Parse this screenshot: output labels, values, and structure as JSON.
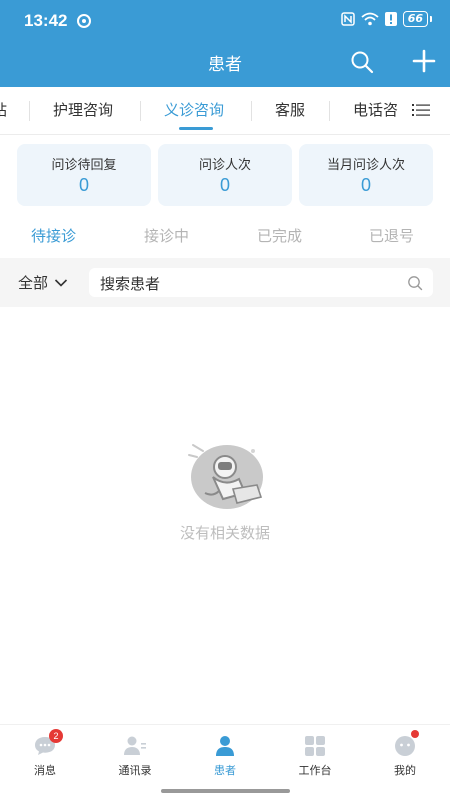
{
  "status_bar": {
    "time": "13:42",
    "battery": "66"
  },
  "nav": {
    "title": "患者"
  },
  "tabs": [
    {
      "label": "站"
    },
    {
      "label": "护理咨询"
    },
    {
      "label": "义诊咨询"
    },
    {
      "label": "客服"
    },
    {
      "label": "电话咨"
    }
  ],
  "stats": [
    {
      "label": "问诊待回复",
      "value": "0"
    },
    {
      "label": "问诊人次",
      "value": "0"
    },
    {
      "label": "当月问诊人次",
      "value": "0"
    }
  ],
  "status_tabs": [
    {
      "label": "待接诊"
    },
    {
      "label": "接诊中"
    },
    {
      "label": "已完成"
    },
    {
      "label": "已退号"
    }
  ],
  "filter": {
    "selected": "全部",
    "search_placeholder": "搜索患者"
  },
  "empty_state": {
    "text": "没有相关数据"
  },
  "bottom_nav": [
    {
      "label": "消息",
      "badge": "2"
    },
    {
      "label": "通讯录"
    },
    {
      "label": "患者"
    },
    {
      "label": "工作台"
    },
    {
      "label": "我的"
    }
  ],
  "colors": {
    "primary": "#3a9bd5",
    "badge": "#e53935",
    "card_bg": "#eef5fb"
  }
}
